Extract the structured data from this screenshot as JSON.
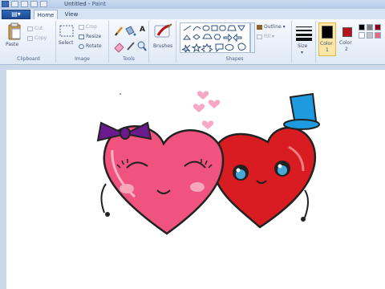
{
  "window": {
    "title_doc": "Untitled",
    "title_sep": " - ",
    "title_app": "Paint"
  },
  "tabs": [
    {
      "label": "Home"
    },
    {
      "label": "View"
    }
  ],
  "app_menu_glyph": "▤▾",
  "ribbon": {
    "clipboard": {
      "paste_label": "Paste",
      "cut_label": "Cut",
      "copy_label": "Copy",
      "group_label": "Clipboard"
    },
    "image": {
      "select_label": "Select",
      "crop_label": "Crop",
      "resize_label": "Resize",
      "rotate_label": "Rotate",
      "group_label": "Image"
    },
    "tools": {
      "group_label": "Tools",
      "text_glyph": "A"
    },
    "brushes": {
      "label": "Brushes"
    },
    "shapes": {
      "outline_label": "Outline",
      "fill_label": "Fill",
      "group_label": "Shapes"
    },
    "size": {
      "label": "Size"
    },
    "colors": {
      "color1_label": "Color",
      "color1_index": "1",
      "color2_label": "Color",
      "color2_index": "2",
      "color1_value": "#000000",
      "color2_value": "#b5121b",
      "palette_row1": [
        "#000000",
        "#7f7f7f",
        "#880015"
      ],
      "palette_row2": [
        "#ffffff",
        "#c3c3c3",
        "#e06a84"
      ]
    }
  },
  "drawing": {
    "left_heart_color": "#f0547e",
    "right_heart_color": "#d81c22",
    "bow_color": "#6a1a8c",
    "hat_color": "#1e9be0",
    "small_hearts_color": "#f5a9c6"
  }
}
